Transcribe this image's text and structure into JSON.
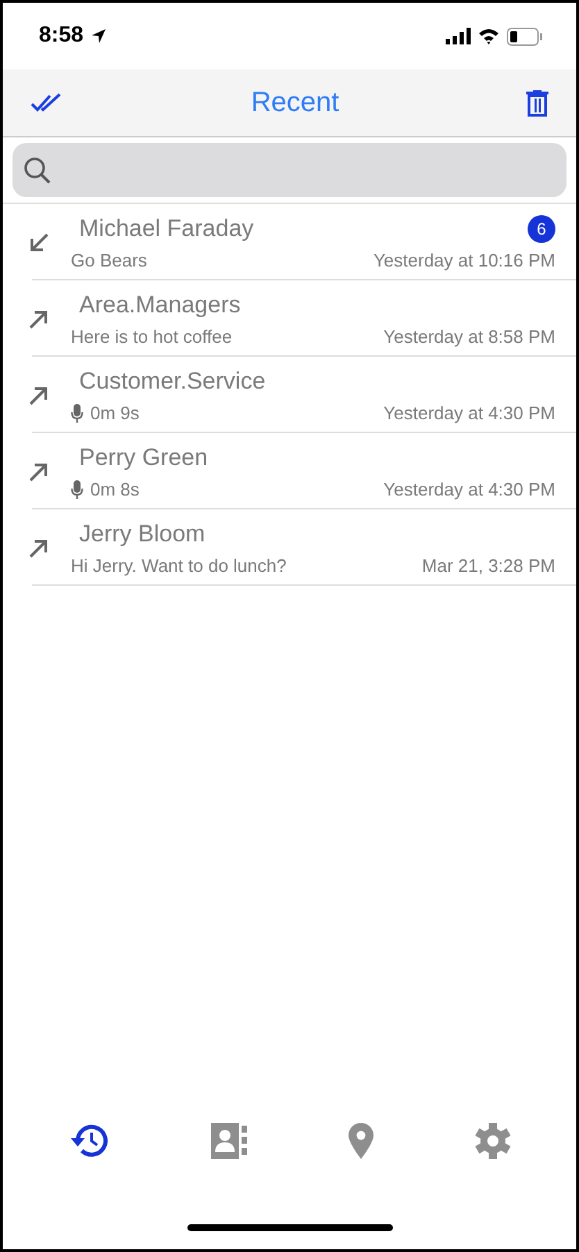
{
  "status_bar": {
    "time": "8:58"
  },
  "nav": {
    "title": "Recent"
  },
  "calls": [
    {
      "name": "Michael Faraday",
      "kind": "incoming",
      "preview": {
        "kind": "text",
        "text": "Go Bears"
      },
      "time": "Yesterday at 10:16 PM",
      "badge": "6"
    },
    {
      "name": "Area.Managers",
      "kind": "outgoing",
      "preview": {
        "kind": "text",
        "text": "Here is to hot coffee"
      },
      "time": "Yesterday at 8:58 PM"
    },
    {
      "name": "Customer.Service",
      "kind": "outgoing",
      "preview": {
        "kind": "voice",
        "text": "0m 9s"
      },
      "time": "Yesterday at 4:30 PM"
    },
    {
      "name": "Perry Green",
      "kind": "outgoing",
      "preview": {
        "kind": "voice",
        "text": "0m 8s"
      },
      "time": "Yesterday at 4:30 PM"
    },
    {
      "name": "Jerry Bloom",
      "kind": "outgoing",
      "preview": {
        "kind": "text",
        "text": "Hi Jerry. Want to do lunch?"
      },
      "time": "Mar 21, 3:28 PM"
    }
  ],
  "tabs": [
    {
      "kind": "recent",
      "selected": true
    },
    {
      "kind": "contacts",
      "selected": false
    },
    {
      "kind": "location",
      "selected": false
    },
    {
      "kind": "settings",
      "selected": false
    }
  ]
}
